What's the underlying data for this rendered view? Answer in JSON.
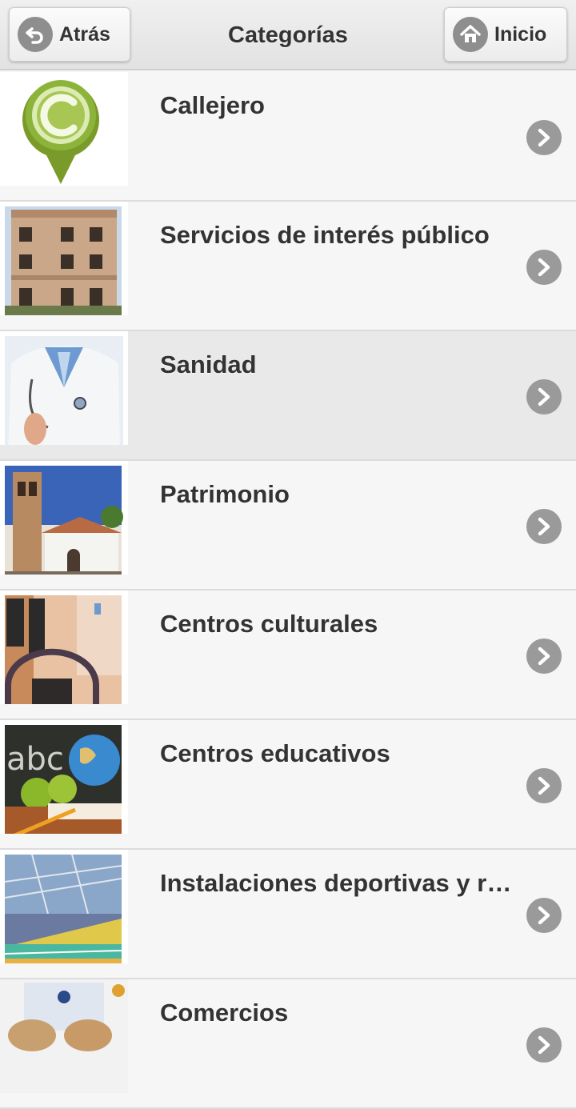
{
  "header": {
    "title": "Categorías",
    "back_label": "Atrás",
    "home_label": "Inicio"
  },
  "categories": [
    {
      "label": "Callejero",
      "icon": "map-pin-c-logo"
    },
    {
      "label": "Servicios de interés público",
      "icon": "town-hall-photo"
    },
    {
      "label": "Sanidad",
      "icon": "doctor-photo"
    },
    {
      "label": "Patrimonio",
      "icon": "church-tower-photo"
    },
    {
      "label": "Centros culturales",
      "icon": "cultural-center-photo"
    },
    {
      "label": "Centros educativos",
      "icon": "school-supplies-photo"
    },
    {
      "label": "Instalaciones deportivas y re...",
      "icon": "sports-hall-photo"
    },
    {
      "label": "Comercios",
      "icon": "shop-photo"
    }
  ]
}
